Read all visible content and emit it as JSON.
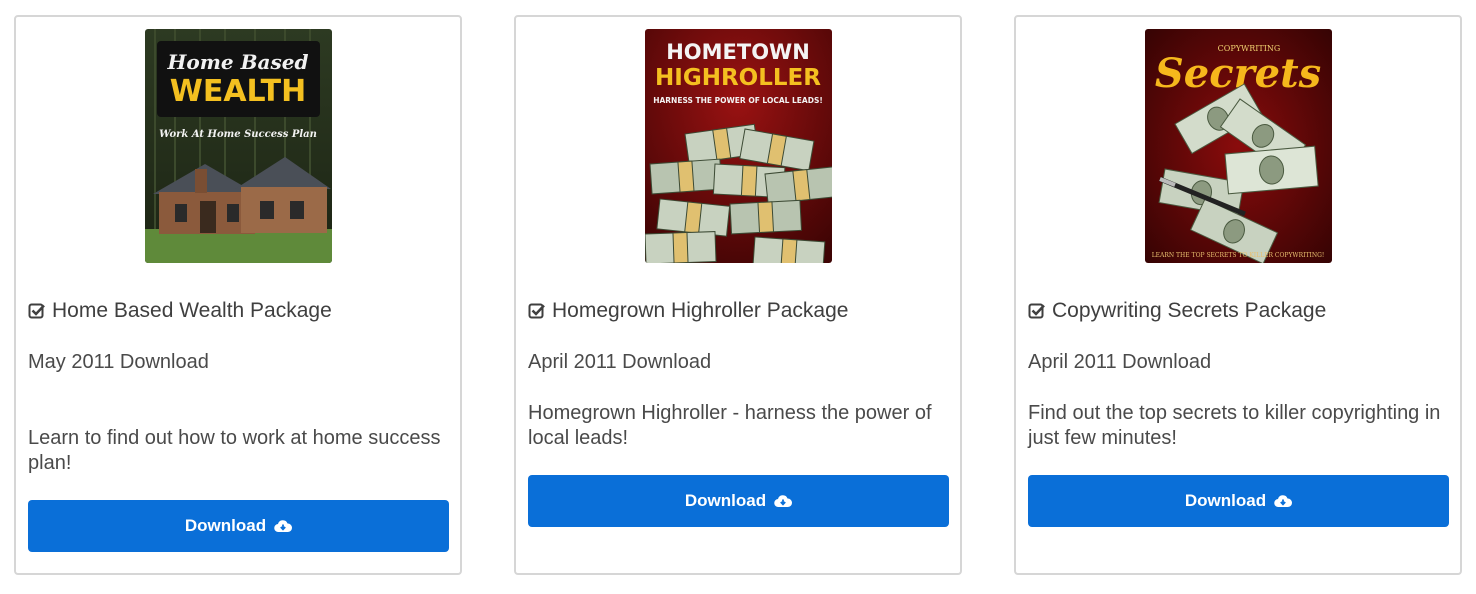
{
  "products": [
    {
      "title": "Home Based Wealth Package",
      "date": "May 2011 Download",
      "description": "Learn to find out how to work at home success plan!",
      "button_label": "Download",
      "cover": {
        "line1": "Home Based",
        "line2": "WEALTH",
        "line3": "Work At Home Success Plan"
      }
    },
    {
      "title": "Homegrown Highroller Package",
      "date": "April 2011 Download",
      "description": "Homegrown Highroller - harness the power of local leads!",
      "button_label": "Download",
      "cover": {
        "line1": "HOMETOWN",
        "line2": "HIGHROLLER",
        "line3": "HARNESS THE POWER OF LOCAL LEADS!"
      }
    },
    {
      "title": "Copywriting Secrets Package",
      "date": "April 2011 Download",
      "description": "Find out the top secrets to killer copyrighting in just few minutes!",
      "button_label": "Download",
      "cover": {
        "line1": "COPYWRITING",
        "line2": "Secrets",
        "line3": "LEARN THE TOP SECRETS TO KILLER COPYWRITING!"
      }
    }
  ],
  "colors": {
    "button": "#0a6fd8",
    "border": "#d6d6d6"
  },
  "icons": {
    "title": "check-square-icon",
    "button": "cloud-download-icon"
  }
}
